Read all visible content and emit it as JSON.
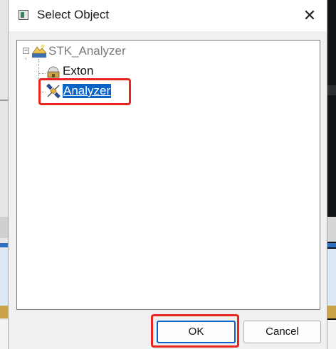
{
  "dialog": {
    "title": "Select Object",
    "close_glyph": "✕"
  },
  "tree": {
    "root": {
      "label": "STK_Analyzer",
      "icon": "scenario-icon",
      "expander": "−"
    },
    "children": [
      {
        "label": "Exton",
        "icon": "facility-icon"
      },
      {
        "label": "Analyzer",
        "icon": "satellite-icon",
        "selected": true
      }
    ]
  },
  "buttons": {
    "ok": "OK",
    "cancel": "Cancel"
  },
  "colors": {
    "selection": "#0a64c8",
    "highlight_annotation": "#e8261f"
  }
}
